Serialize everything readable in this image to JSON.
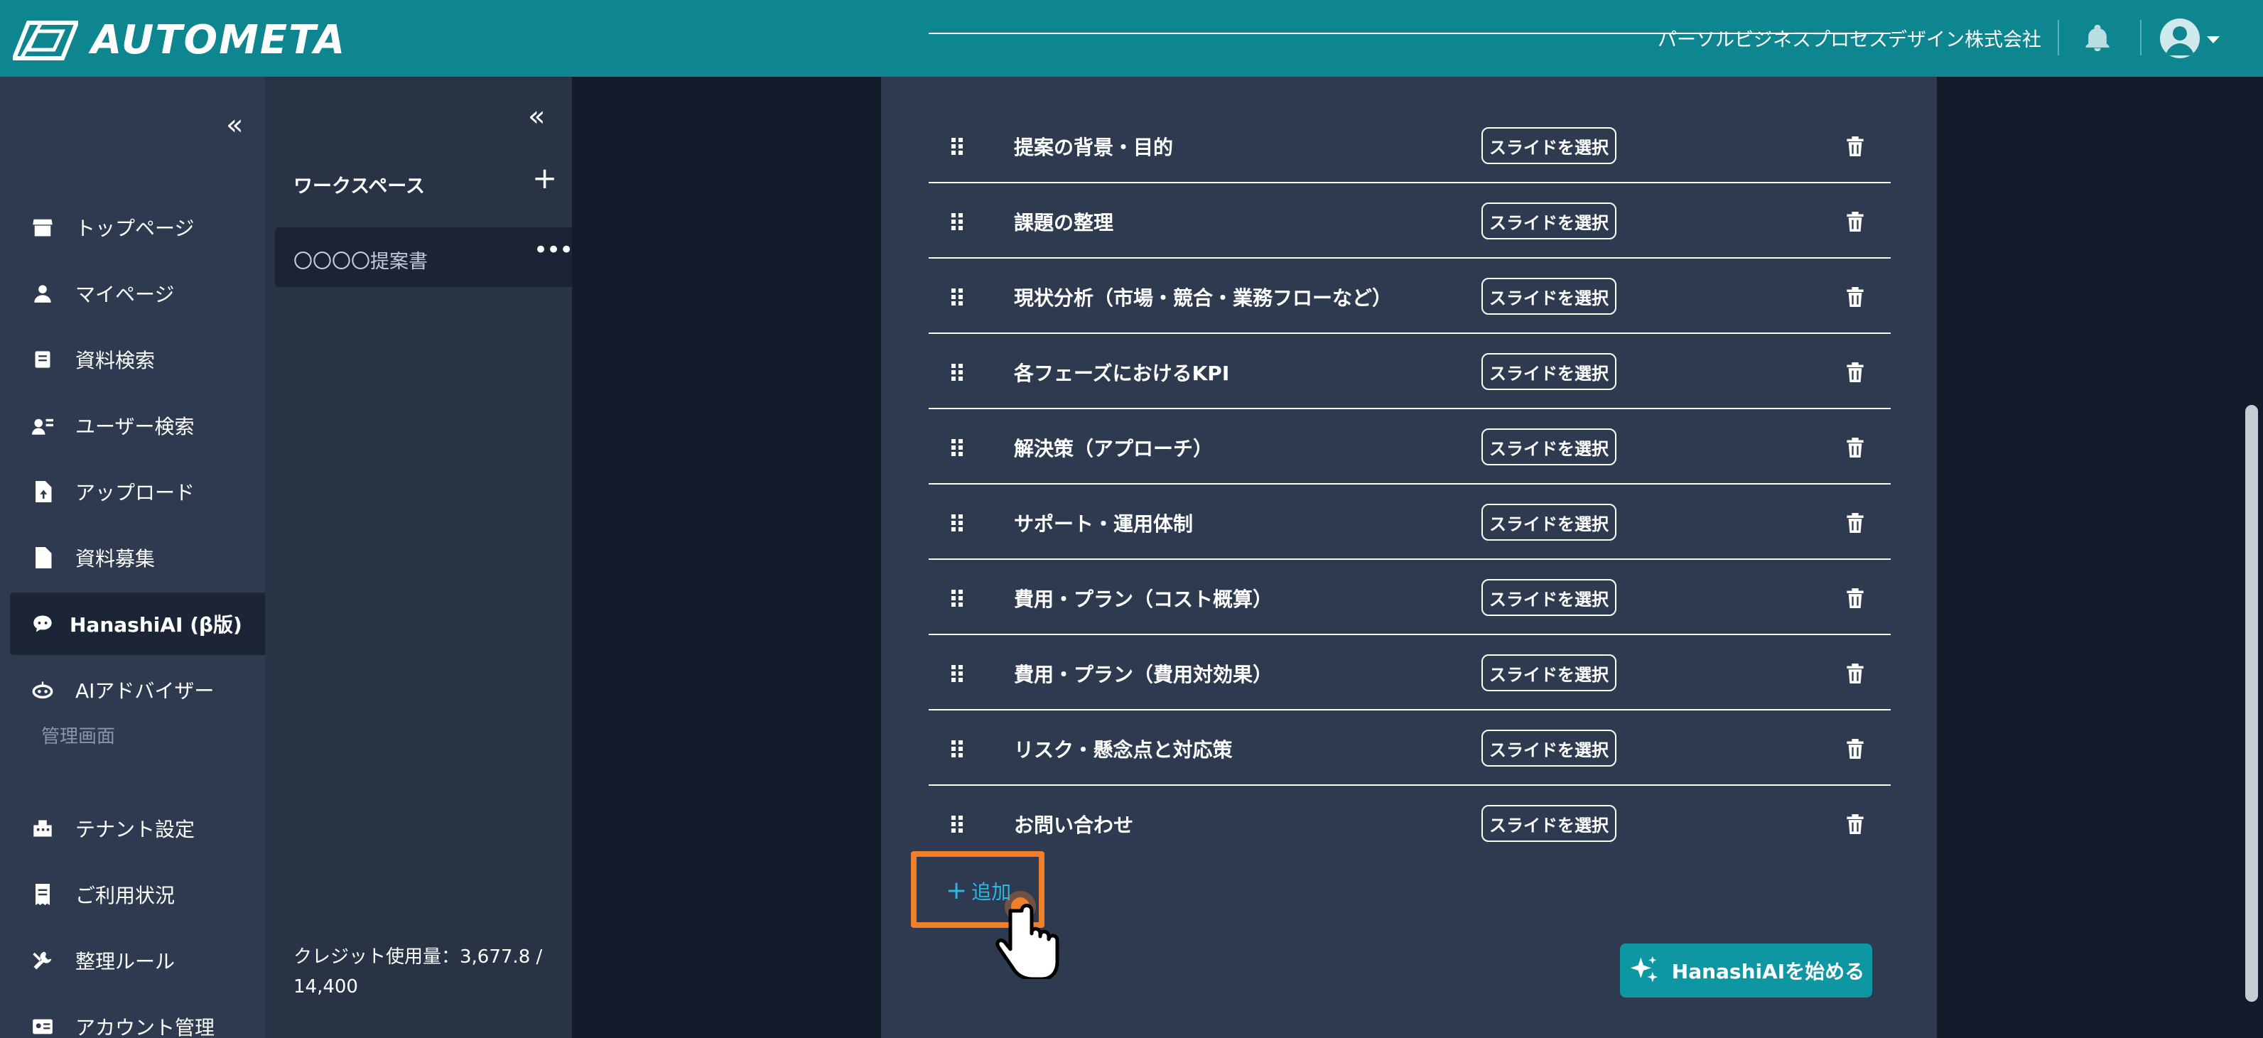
{
  "app": {
    "logo_text": "AUTOMETA",
    "company_name": "パーソルビジネスプロセスデザイン株式会社"
  },
  "nav": {
    "items": [
      {
        "label": "トップページ",
        "icon": "store-icon"
      },
      {
        "label": "マイページ",
        "icon": "person-icon"
      },
      {
        "label": "資料検索",
        "icon": "document-search-icon"
      },
      {
        "label": "ユーザー検索",
        "icon": "user-search-icon"
      },
      {
        "label": "アップロード",
        "icon": "file-upload-icon"
      },
      {
        "label": "資料募集",
        "icon": "file-icon"
      },
      {
        "label": "HanashiAI (β版)",
        "icon": "chat-bot-icon",
        "active": true
      },
      {
        "label": "AIアドバイザー",
        "icon": "robot-icon"
      }
    ],
    "admin_section": "管理画面",
    "admin_items": [
      {
        "label": "テナント設定",
        "icon": "building-icon"
      },
      {
        "label": "ご利用状況",
        "icon": "receipt-icon"
      },
      {
        "label": "整理ルール",
        "icon": "tools-icon"
      },
      {
        "label": "アカウント管理",
        "icon": "id-card-icon"
      }
    ]
  },
  "workspace": {
    "title": "ワークスペース",
    "items": [
      {
        "label": "〇〇〇〇提案書"
      }
    ],
    "credit_label": "クレジット使用量：3,677.8 /",
    "credit_total": "14,400"
  },
  "outline": {
    "select_label": "スライドを選択",
    "rows": [
      {
        "title": "提案の背景・目的"
      },
      {
        "title": "課題の整理"
      },
      {
        "title": "現状分析（市場・競合・業務フローなど）"
      },
      {
        "title": "各フェーズにおけるKPI"
      },
      {
        "title": "解決策（アプローチ）"
      },
      {
        "title": "サポート・運用体制"
      },
      {
        "title": "費用・プラン（コスト概算）"
      },
      {
        "title": "費用・プラン（費用対効果）"
      },
      {
        "title": "リスク・懸念点と対応策"
      },
      {
        "title": "お問い合わせ"
      }
    ],
    "add_label": "追加"
  },
  "actions": {
    "start_label": "HanashiAIを始める"
  },
  "colors": {
    "header": "#0e8690",
    "highlight": "#f07f2c",
    "accent": "#2bb7e0"
  }
}
